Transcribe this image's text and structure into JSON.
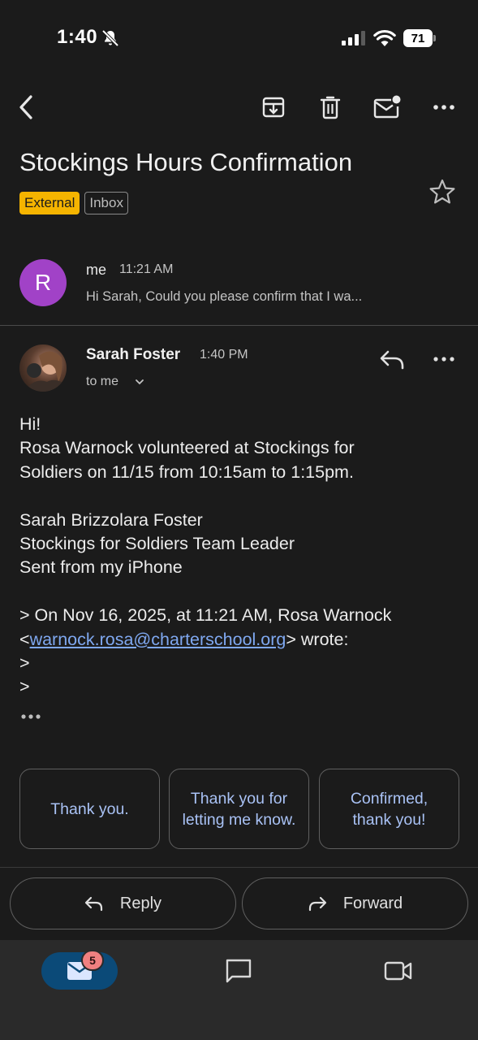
{
  "status_bar": {
    "time": "1:40",
    "battery": "71"
  },
  "email": {
    "subject": "Stockings Hours Confirmation",
    "labels": {
      "external": "External",
      "inbox": "Inbox"
    },
    "collapsed": {
      "avatar_initial": "R",
      "sender": "me",
      "time": "11:21 AM",
      "snippet": "Hi Sarah, Could you please confirm that I wa..."
    },
    "message": {
      "sender": "Sarah Foster",
      "time": "1:40 PM",
      "to": "to me",
      "body": {
        "greeting": "Hi!",
        "line1": "Rosa Warnock volunteered at Stockings for",
        "line2": "Soldiers on 11/15 from 10:15am to 1:15pm.",
        "sig1": "Sarah Brizzolara Foster",
        "sig2": "Stockings for Soldiers Team Leader",
        "sig3": "Sent from my iPhone",
        "quote1": "> On Nov 16, 2025, at 11:21 AM, Rosa Warnock",
        "quote2_prefix": "<",
        "quote2_link": "warnock.rosa@charterschool.org",
        "quote2_suffix": "> wrote:",
        "quote3": ">",
        "quote4": ">"
      }
    }
  },
  "smart_replies": [
    "Thank you.",
    "Thank you for letting me know.",
    "Confirmed, thank you!"
  ],
  "actions": {
    "reply": "Reply",
    "forward": "Forward"
  },
  "bottom_nav": {
    "mail_badge": "5"
  },
  "colors": {
    "accent": "#0b4a78",
    "external_chip": "#f5b400",
    "avatar_r": "#a142c7",
    "link": "#7fa8f0"
  }
}
